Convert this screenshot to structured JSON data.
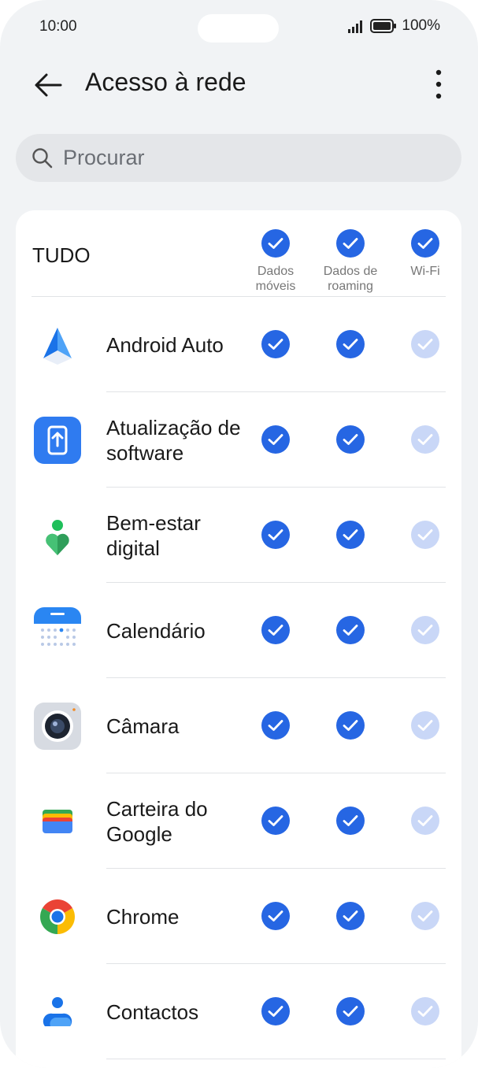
{
  "status": {
    "time": "10:00",
    "battery": "100%"
  },
  "header": {
    "title": "Acesso à rede"
  },
  "search": {
    "placeholder": "Procurar"
  },
  "table": {
    "all_label": "TUDO",
    "columns": [
      "Dados móveis",
      "Dados de roaming",
      "Wi-Fi"
    ],
    "column_states": [
      "checked",
      "checked",
      "checked"
    ],
    "apps": [
      {
        "name": "Android Auto",
        "icon": "android-auto-icon",
        "mobile": "checked",
        "roaming": "checked",
        "wifi": "checked-disabled"
      },
      {
        "name": "Atualização de software",
        "icon": "software-update-icon",
        "mobile": "checked",
        "roaming": "checked",
        "wifi": "checked-disabled"
      },
      {
        "name": "Bem-estar digital",
        "icon": "digital-wellbeing-icon",
        "mobile": "checked",
        "roaming": "checked",
        "wifi": "checked-disabled"
      },
      {
        "name": "Calendário",
        "icon": "calendar-icon",
        "mobile": "checked",
        "roaming": "checked",
        "wifi": "checked-disabled"
      },
      {
        "name": "Câmara",
        "icon": "camera-icon",
        "mobile": "checked",
        "roaming": "checked",
        "wifi": "checked-disabled"
      },
      {
        "name": "Carteira do Google",
        "icon": "google-wallet-icon",
        "mobile": "checked",
        "roaming": "checked",
        "wifi": "checked-disabled"
      },
      {
        "name": "Chrome",
        "icon": "chrome-icon",
        "mobile": "checked",
        "roaming": "checked",
        "wifi": "checked-disabled"
      },
      {
        "name": "Contactos",
        "icon": "contacts-icon",
        "mobile": "checked",
        "roaming": "checked",
        "wifi": "checked-disabled"
      }
    ]
  },
  "colors": {
    "accent": "#2666e3",
    "accent_disabled": "#c9d7f7",
    "background": "#f1f3f5"
  }
}
